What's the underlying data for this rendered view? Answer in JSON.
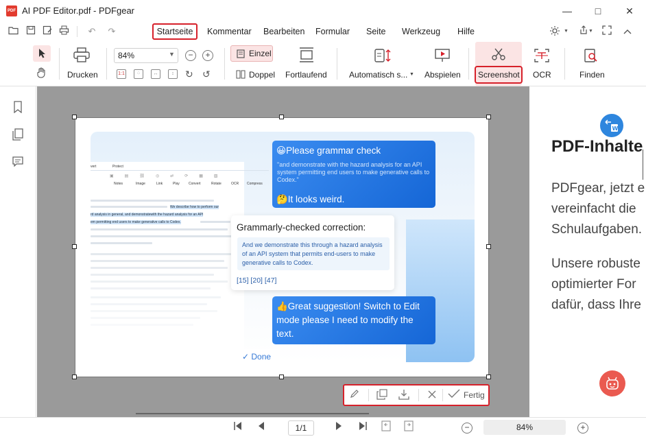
{
  "window": {
    "title": "AI PDF Editor.pdf - PDFgear",
    "logo_text": "PDF",
    "minimize": "—",
    "maximize": "□",
    "close": "✕"
  },
  "quick_access": {
    "open_icon": "📂",
    "save_icon": "💾",
    "saveas_icon": "📝",
    "print_icon": "🖨",
    "undo_icon": "↶",
    "redo_icon": "↷"
  },
  "menu": {
    "items": [
      "Startseite",
      "Kommentar",
      "Bearbeiten",
      "Formular",
      "Seite",
      "Werkzeug",
      "Hilfe"
    ],
    "active": "Startseite"
  },
  "ribbon": {
    "print_label": "Drucken",
    "zoom_value": "84%",
    "einzel_label": "Einzel",
    "doppel_label": "Doppel",
    "fortlaufend_label": "Fortlaufend",
    "automatisch_label": "Automatisch s...",
    "abspielen_label": "Abspielen",
    "screenshot_label": "Screenshot",
    "ocr_label": "OCR",
    "finden_label": "Finden"
  },
  "right_page": {
    "heading": "PDF-Inhalte",
    "para1": [
      "PDFgear, jetzt e",
      "vereinfacht die",
      "Schulaufgaben."
    ],
    "para2": [
      "Unsere robuste",
      "optimierter For",
      "dafür, dass Ihre"
    ]
  },
  "screenshot": {
    "toolbar_tabs": [
      "vert",
      "Protect"
    ],
    "toolbar_items": [
      "Notes",
      "Image",
      "Link",
      "Play",
      "Convert",
      "Rotate",
      "OCR",
      "Compress"
    ],
    "doc_highlight": [
      "We describe how to perform our",
      "rd analysis in general, and demonstratewith the hazard analysis for an API",
      "em permitting end users to make generative calls to Codex."
    ],
    "bubble1": {
      "title": "😀Please grammar check",
      "quote": "\"and demonstrate with the hazard analysis for an API system permitting end users to make generative calls to Codex.\"",
      "reply": "🤔It looks weird."
    },
    "correction": {
      "title": "Grammarly-checked correction:",
      "body": "And we demonstrate this through a hazard analysis of an API system that permits end-users to make generative calls to Codex.",
      "refs": "[15] [20] [47]"
    },
    "bubble2": {
      "text": "👍Great suggestion! Switch to Edit mode please I need to modify the text."
    },
    "done": "✓ Done"
  },
  "action_bar": {
    "fertig": "Fertig"
  },
  "bottom": {
    "page": "1/1",
    "zoom": "84%"
  }
}
